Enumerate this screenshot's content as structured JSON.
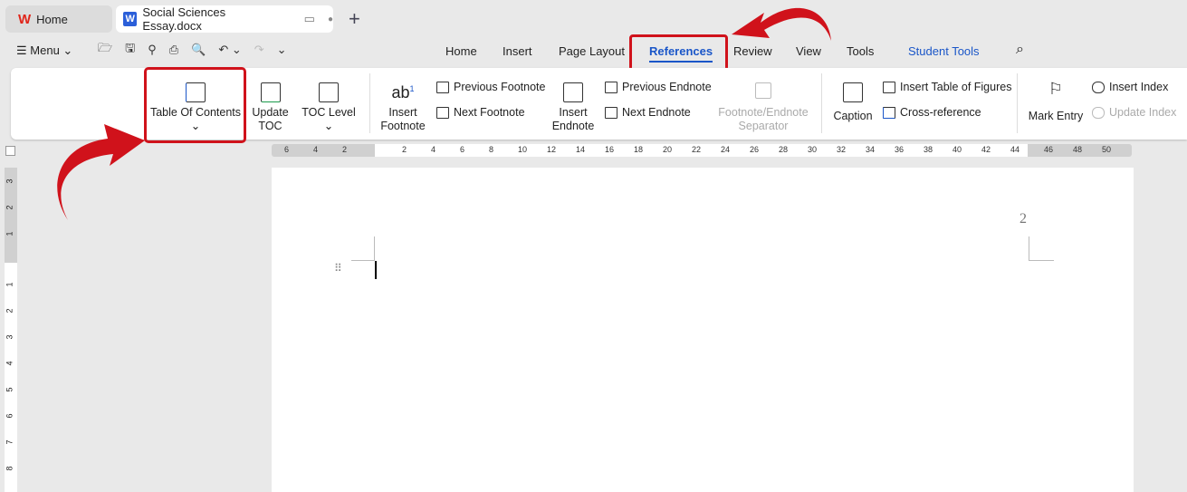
{
  "tabs": {
    "home": "Home",
    "doc": "Social Sciences Essay.docx",
    "new": "+"
  },
  "toolbar": {
    "menu": "Menu"
  },
  "nav": [
    "Home",
    "Insert",
    "Page Layout",
    "References",
    "Review",
    "View",
    "Tools",
    "Student Tools"
  ],
  "ribbon": {
    "toc": "Table Of Contents",
    "update_toc_1": "Update",
    "update_toc_2": "TOC",
    "toc_level": "TOC Level",
    "insert_footnote_1": "Insert",
    "insert_footnote_2": "Footnote",
    "prev_footnote": "Previous Footnote",
    "next_footnote": "Next Footnote",
    "insert_endnote_1": "Insert",
    "insert_endnote_2": "Endnote",
    "prev_endnote": "Previous Endnote",
    "next_endnote": "Next Endnote",
    "separator_1": "Footnote/Endnote",
    "separator_2": "Separator",
    "caption": "Caption",
    "table_of_figures": "Insert Table of Figures",
    "cross_reference": "Cross-reference",
    "mark_entry": "Mark Entry",
    "insert_index": "Insert Index",
    "update_index": "Update Index"
  },
  "ruler": {
    "left": [
      "6",
      "4",
      "2"
    ],
    "main": [
      "2",
      "4",
      "6",
      "8",
      "10",
      "12",
      "14",
      "16",
      "18",
      "20",
      "22",
      "24",
      "26",
      "28",
      "30",
      "32",
      "34",
      "36",
      "38",
      "40",
      "42",
      "44"
    ],
    "right": [
      "46",
      "48",
      "50"
    ]
  },
  "vruler": {
    "top": [
      "3",
      "2",
      "1"
    ],
    "main": [
      "1",
      "2",
      "3",
      "4",
      "5",
      "6",
      "7",
      "8"
    ]
  },
  "page": {
    "number": "2"
  },
  "colors": {
    "accent": "#1a56c8",
    "highlight": "#d0121b"
  }
}
